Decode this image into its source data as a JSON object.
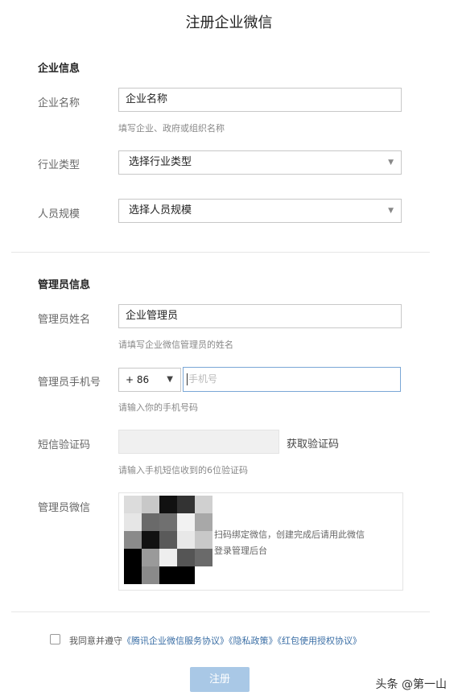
{
  "page": {
    "title": "注册企业微信"
  },
  "company": {
    "section_title": "企业信息",
    "name_label": "企业名称",
    "name_value": "企业名称",
    "name_hint": "填写企业、政府或组织名称",
    "industry_label": "行业类型",
    "industry_value": "选择行业类型",
    "size_label": "人员规模",
    "size_value": "选择人员规模"
  },
  "admin": {
    "section_title": "管理员信息",
    "name_label": "管理员姓名",
    "name_value": "企业管理员",
    "name_hint": "请填写企业微信管理员的姓名",
    "phone_label": "管理员手机号",
    "country_code": "+ 86",
    "phone_placeholder": "手机号",
    "phone_hint": "请输入你的手机号码",
    "sms_label": "短信验证码",
    "sms_button": "获取验证码",
    "sms_hint": "请输入手机短信收到的6位验证码",
    "wechat_label": "管理员微信",
    "qr_text": "扫码绑定微信，创建完成后请用此微信登录管理后台",
    "qr_text_line1": "扫码绑定微信，创建完成后请用此微信",
    "qr_text_line2": "登录管理后台"
  },
  "agreement": {
    "prefix": "我同意并遵守",
    "link1": "《腾讯企业微信服务协议》",
    "link2": "《隐私政策》",
    "link3": "《红包使用授权协议》",
    "checked": false
  },
  "footer": {
    "register_button": "注册"
  },
  "watermark": {
    "text": "头条 @第一山"
  },
  "icons": {
    "caret": "caret-down-icon"
  },
  "colors": {
    "accent": "#7aa7d6",
    "button": "#a9c8e6",
    "link": "#3a6ea5"
  }
}
